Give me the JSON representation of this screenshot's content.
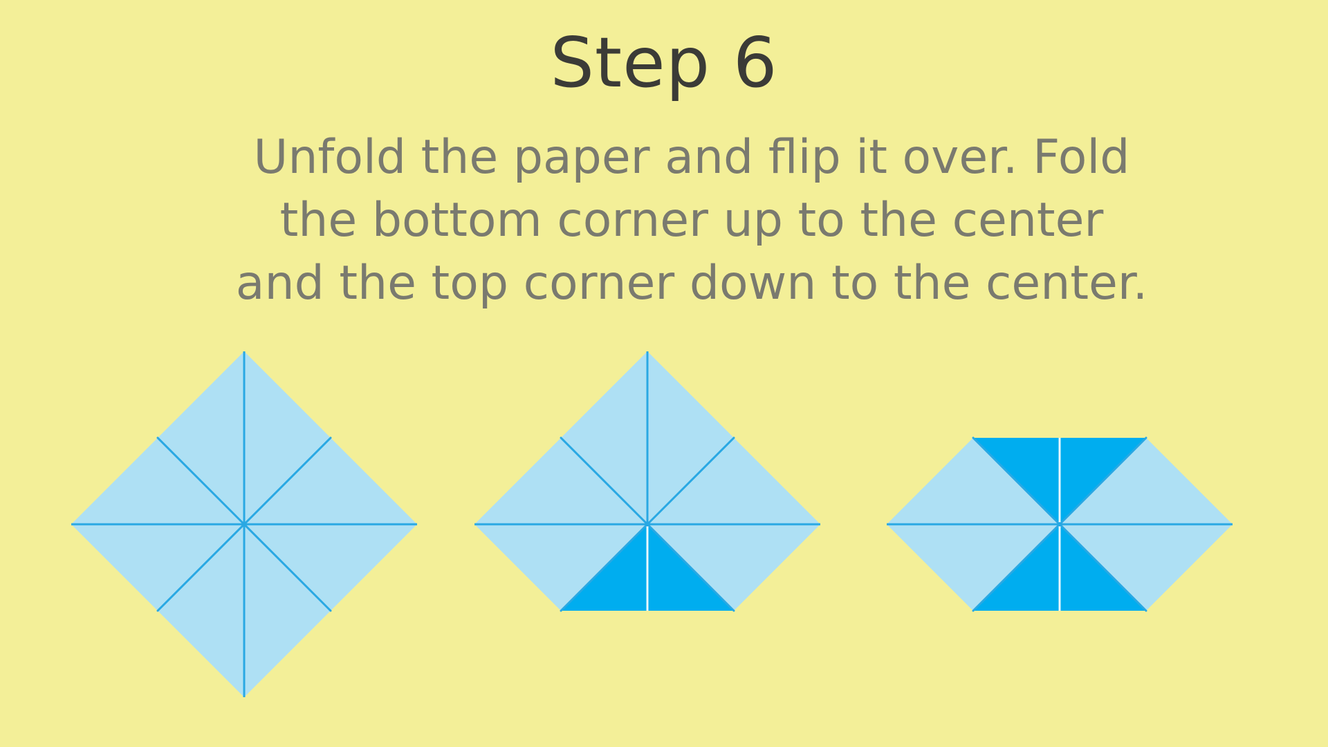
{
  "step_title": "Step 6",
  "instructions": "Unfold the paper and flip it over. Fold the bottom corner up to the center and the top corner down to the center.",
  "colors": {
    "background": "#f3ef98",
    "paper_light": "#aee0f4",
    "paper_folded": "#00adef",
    "crease_line": "#29a8e3",
    "fold_edge": "#e9f7fd"
  },
  "figures": [
    {
      "name": "unfolded-square",
      "folded_corners": []
    },
    {
      "name": "bottom-corner-folded",
      "folded_corners": [
        "bottom"
      ]
    },
    {
      "name": "both-corners-folded",
      "folded_corners": [
        "bottom",
        "top"
      ]
    }
  ]
}
